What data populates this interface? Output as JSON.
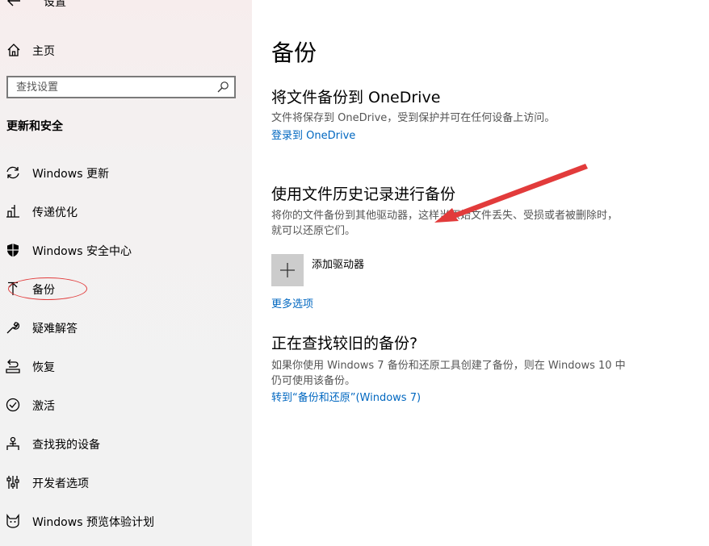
{
  "app": {
    "title": "设置",
    "home_label": "主页",
    "search_placeholder": "查找设置",
    "section_title": "更新和安全"
  },
  "nav_items": [
    {
      "label": "Windows 更新",
      "icon": "sync-icon"
    },
    {
      "label": "传递优化",
      "icon": "delivery-optimization-icon"
    },
    {
      "label": "Windows 安全中心",
      "icon": "shield-icon"
    },
    {
      "label": "备份",
      "icon": "backup-arrow-icon"
    },
    {
      "label": "疑难解答",
      "icon": "wrench-icon"
    },
    {
      "label": "恢复",
      "icon": "recovery-icon"
    },
    {
      "label": "激活",
      "icon": "check-circle-icon"
    },
    {
      "label": "查找我的设备",
      "icon": "find-device-icon"
    },
    {
      "label": "开发者选项",
      "icon": "developer-icon"
    },
    {
      "label": "Windows 预览体验计划",
      "icon": "insider-cat-icon"
    }
  ],
  "main": {
    "title": "备份",
    "onedrive": {
      "heading": "将文件备份到 OneDrive",
      "desc": "文件将保存到 OneDrive，受到保护并可在任何设备上访问。",
      "link": "登录到 OneDrive"
    },
    "history": {
      "heading": "使用文件历史记录进行备份",
      "desc": "将你的文件备份到其他驱动器，这样当原始文件丢失、受损或者被删除时，就可以还原它们。",
      "add_drive": "添加驱动器",
      "more_options": "更多选项"
    },
    "older": {
      "heading": "正在查找较旧的备份?",
      "desc": "如果你使用 Windows 7 备份和还原工具创建了备份，则在 Windows 10 中仍可使用该备份。",
      "link": "转到“备份和还原”(Windows 7)"
    }
  },
  "colors": {
    "link": "#0067c0",
    "annotation": "#e23b3b",
    "sidebar_bg": "#f2f2f2"
  }
}
